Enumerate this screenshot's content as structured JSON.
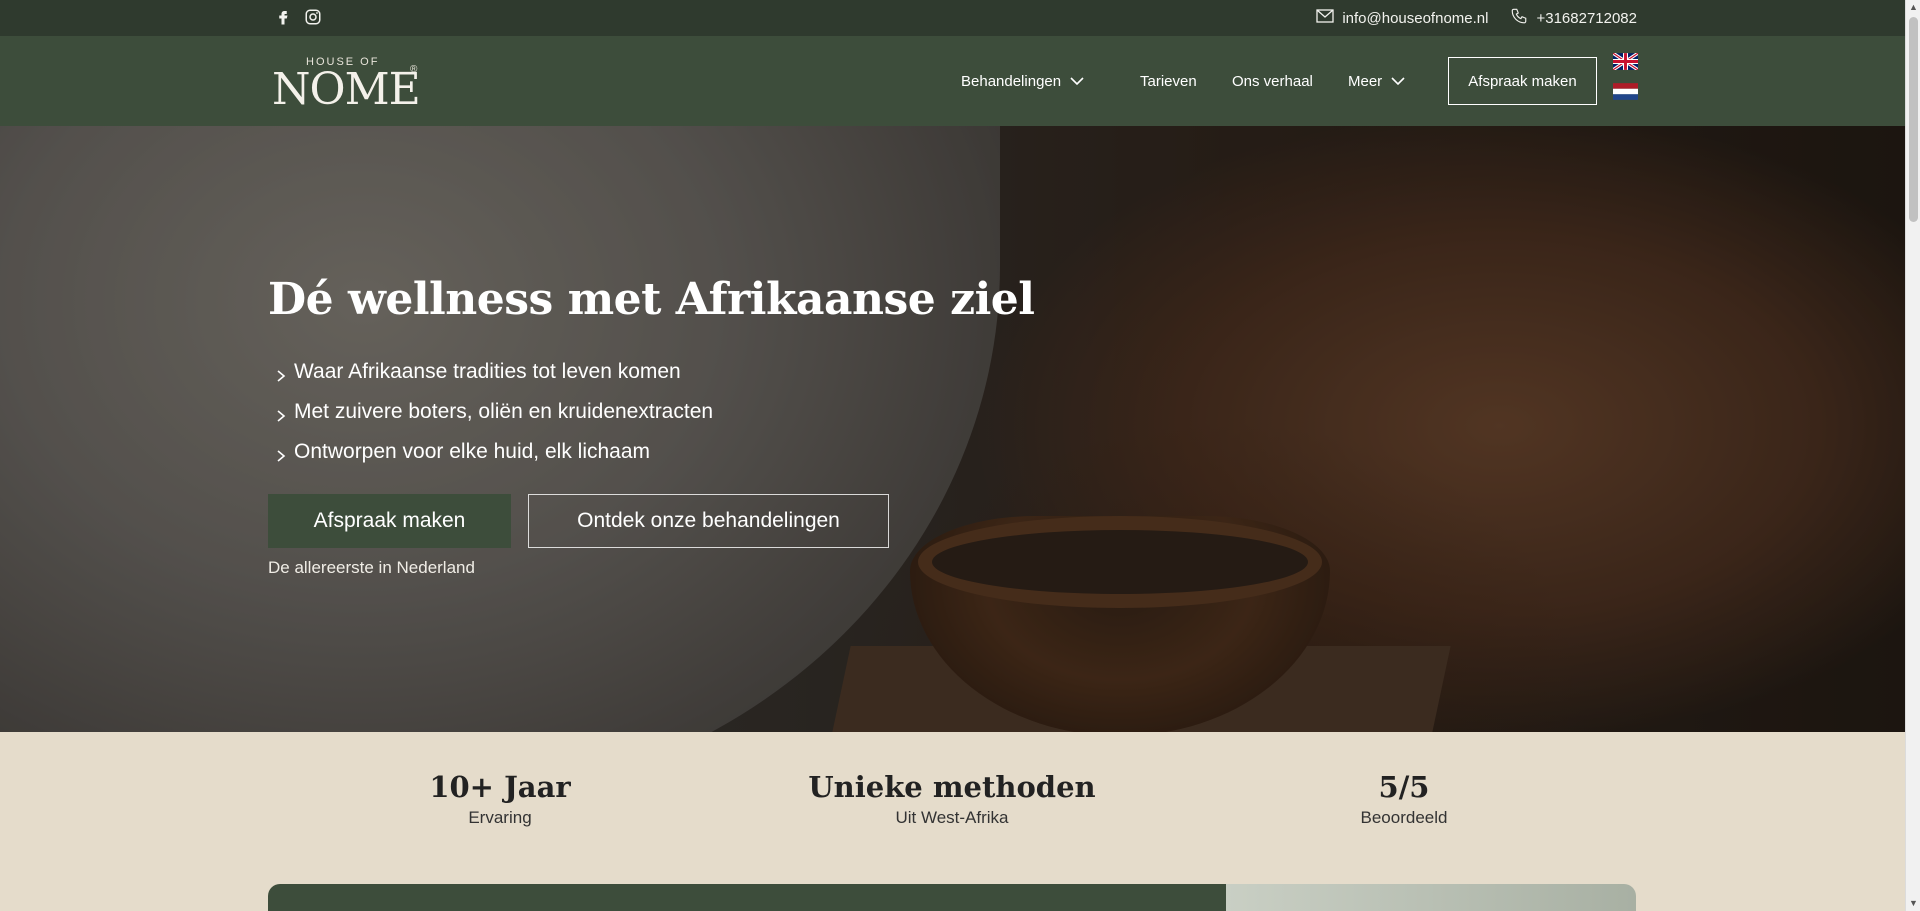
{
  "topbar": {
    "social": [
      "facebook-icon",
      "instagram-icon"
    ],
    "email": "info@houseofnome.nl",
    "phone": "+31682712082"
  },
  "header": {
    "logo": {
      "small": "HOUSE OF",
      "big": "NOME",
      "reg": "®"
    },
    "nav": [
      {
        "label": "Behandelingen",
        "has_dropdown": true
      },
      {
        "label": "Tarieven",
        "has_dropdown": false
      },
      {
        "label": "Ons verhaal",
        "has_dropdown": false
      },
      {
        "label": "Meer",
        "has_dropdown": true
      }
    ],
    "cta": "Afspraak maken",
    "languages": [
      "en",
      "nl"
    ]
  },
  "hero": {
    "title": "Dé wellness met Afrikaanse ziel",
    "bullets": [
      "Waar Afrikaanse tradities tot leven komen",
      "Met zuivere boters, oliën en kruidenextracten",
      "Ontworpen voor elke huid, elk lichaam"
    ],
    "primary_button": "Afspraak maken",
    "secondary_button": "Ontdek onze behandelingen",
    "note": "De allereerste in Nederland"
  },
  "stats": [
    {
      "value": "10+ Jaar",
      "label": "Ervaring"
    },
    {
      "value": "Unieke methoden",
      "label": "Uit West-Afrika"
    },
    {
      "value": "5/5",
      "label": "Beoordeeld"
    }
  ],
  "colors": {
    "topbar_bg": "#2f3a2e",
    "header_bg": "#3d4d3b",
    "accent_green": "#3d4d3b",
    "stats_bg": "#e5dccb"
  }
}
